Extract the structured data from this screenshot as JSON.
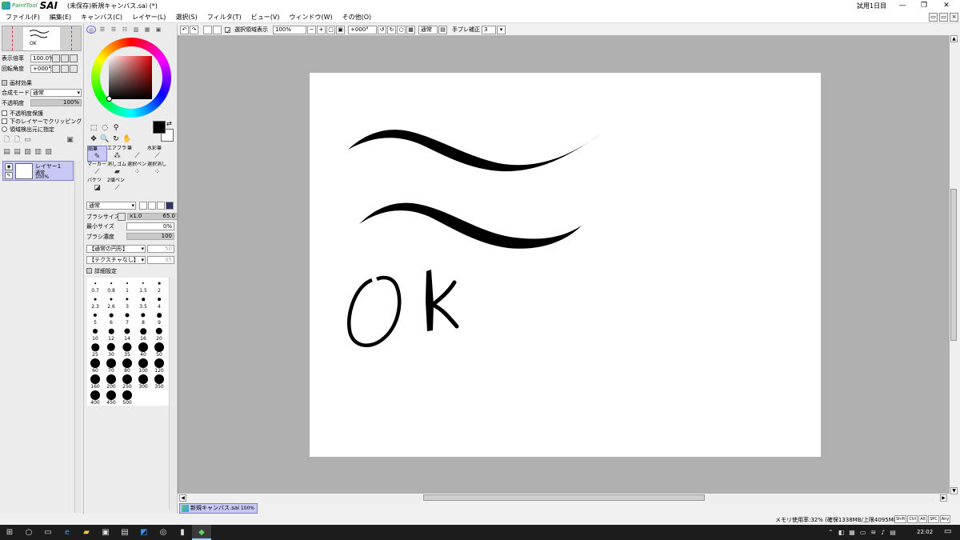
{
  "titlebar": {
    "logo_small": "PaintTool",
    "logo_main": "SAI",
    "document": "(未保存)新規キャンバス.sai (*)",
    "trial": "試用1日目",
    "minimize": "—",
    "maximize": "❐",
    "close": "✕"
  },
  "menu": [
    "ファイル(F)",
    "編集(E)",
    "キャンバス(C)",
    "レイヤー(L)",
    "選択(S)",
    "フィルタ(T)",
    "ビュー(V)",
    "ウィンドウ(W)",
    "その他(O)"
  ],
  "navigator": {
    "zoom_label": "表示倍率",
    "zoom_value": "100.0%",
    "rotate_label": "回転角度",
    "rotate_value": "+000°"
  },
  "layer_props": {
    "effects_label": "画材効果",
    "blend_label": "合成モード",
    "blend_value": "通常",
    "opacity_label": "不透明度",
    "opacity_value": "100%",
    "opt_protect": "不透明度保護",
    "opt_clip": "下のレイヤーでクリッピング",
    "opt_source": "領域検出元に指定"
  },
  "layer": {
    "name": "レイヤー1",
    "mode": "通常",
    "opacity": "100%"
  },
  "tools": {
    "brushes": [
      {
        "name": "鉛筆",
        "icon": "pencil-icon",
        "glyph": "✎",
        "selected": true
      },
      {
        "name": "エアブラシ",
        "icon": "airbrush-icon",
        "glyph": "⁂",
        "selected": false
      },
      {
        "name": "筆",
        "icon": "brush-icon",
        "glyph": "⟋",
        "selected": false
      },
      {
        "name": "水彩筆",
        "icon": "watercolor-icon",
        "glyph": "⟋",
        "selected": false
      },
      {
        "name": "マーカー",
        "icon": "marker-icon",
        "glyph": "⟋",
        "selected": false
      },
      {
        "name": "消しゴム",
        "icon": "eraser-icon",
        "glyph": "▰",
        "selected": false
      },
      {
        "name": "選択ペン",
        "icon": "select-pen-icon",
        "glyph": "⁘",
        "selected": false
      },
      {
        "name": "選択消し",
        "icon": "select-erase-icon",
        "glyph": "⁘",
        "selected": false
      },
      {
        "name": "バケツ",
        "icon": "bucket-icon",
        "glyph": "◪",
        "selected": false
      },
      {
        "name": "2値ペン",
        "icon": "binary-pen-icon",
        "glyph": "⟋",
        "selected": false
      }
    ],
    "blend_value": "通常",
    "size_label": "ブラシサイズ",
    "size_mult": "x1.0",
    "size_value": "65.0",
    "min_size_label": "最小サイズ",
    "min_size_value": "0%",
    "density_label": "ブラシ濃度",
    "density_value": "100",
    "shape_value": "【通常の円形】",
    "shape_strength": "50",
    "texture_value": "【テクスチャなし】",
    "texture_strength": "95",
    "detail_label": "詳細設定",
    "sizes": [
      "0.7",
      "0.8",
      "1",
      "1.5",
      "2",
      "2.3",
      "2.6",
      "3",
      "3.5",
      "4",
      "5",
      "6",
      "7",
      "8",
      "9",
      "10",
      "12",
      "14",
      "16",
      "20",
      "25",
      "30",
      "35",
      "40",
      "50",
      "60",
      "70",
      "80",
      "100",
      "120",
      "160",
      "200",
      "250",
      "300",
      "350",
      "400",
      "450",
      "500"
    ]
  },
  "canvasbar": {
    "show_selection": "選択領域表示",
    "zoom": "100%",
    "angle": "+000°",
    "blend": "通常",
    "stabilizer_label": "手ブレ補正",
    "stabilizer_value": "3"
  },
  "canvas": {
    "lettering": "OK",
    "stroke_color": "#000000"
  },
  "filetab": {
    "name": "新規キャンバス.sai",
    "zoom": "100%"
  },
  "status": {
    "memory": "メモリ使用率:32% (確保1338MB/上限4095MB)",
    "keys": [
      "Shift",
      "Ctrl",
      "Alt",
      "SPC",
      "Any"
    ]
  },
  "taskbar": {
    "time": "22:02"
  },
  "colors": {
    "foreground": "#000000",
    "background": "#ffffff",
    "hue": "#e00000",
    "selection": "#c8c8f4"
  }
}
